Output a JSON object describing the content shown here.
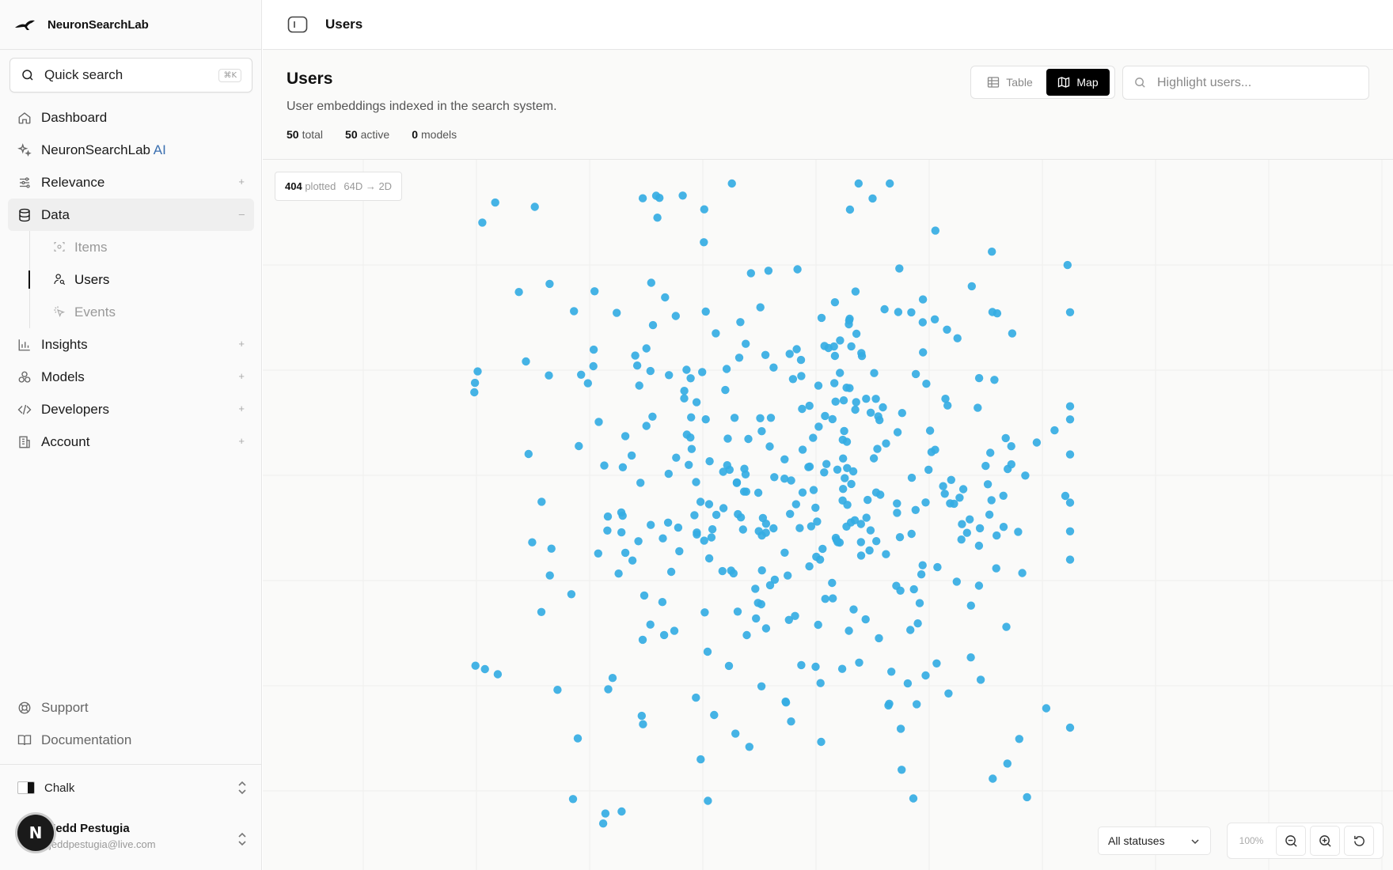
{
  "brand": {
    "name": "NeuronSearchLab"
  },
  "search": {
    "label": "Quick search",
    "shortcut": "⌘K"
  },
  "nav": {
    "items": [
      {
        "label": "Dashboard",
        "icon": "home-icon"
      },
      {
        "label": "NeuronSearchLab AI",
        "icon": "sparkles-icon"
      },
      {
        "label": "Relevance",
        "icon": "sliders-icon",
        "expand": "+"
      },
      {
        "label": "Data",
        "icon": "database-icon",
        "expand": "–"
      },
      {
        "label": "Insights",
        "icon": "bar-chart-icon",
        "expand": "+"
      },
      {
        "label": "Models",
        "icon": "boxes-icon",
        "expand": "+"
      },
      {
        "label": "Developers",
        "icon": "code-icon",
        "expand": "+"
      },
      {
        "label": "Account",
        "icon": "building-icon",
        "expand": "+"
      }
    ],
    "data_sub": [
      {
        "label": "Items",
        "icon": "scan-icon"
      },
      {
        "label": "Users",
        "icon": "user-search-icon"
      },
      {
        "label": "Events",
        "icon": "pointer-click-icon"
      }
    ],
    "bottom": [
      {
        "label": "Support",
        "icon": "lifebuoy-icon"
      },
      {
        "label": "Documentation",
        "icon": "book-icon"
      }
    ]
  },
  "theme": {
    "label": "Chalk"
  },
  "user": {
    "initial": "N",
    "name": "Jedd Pestugia",
    "email": "jeddpestugia@live.com"
  },
  "topbar": {
    "title": "Users"
  },
  "header": {
    "title": "Users",
    "subtitle": "User embeddings indexed in the search system.",
    "stats": [
      {
        "value": "50",
        "label": "total"
      },
      {
        "value": "50",
        "label": "active"
      },
      {
        "value": "0",
        "label": "models"
      }
    ]
  },
  "view_toggle": {
    "table": "Table",
    "map": "Map",
    "selected": "Map"
  },
  "highlight": {
    "placeholder": "Highlight users..."
  },
  "map": {
    "plotted_count": "404",
    "plotted_label": "plotted",
    "projection": "64D → 2D",
    "status_filter": "All statuses",
    "zoom": "100%",
    "point_color": "#35ace3"
  }
}
